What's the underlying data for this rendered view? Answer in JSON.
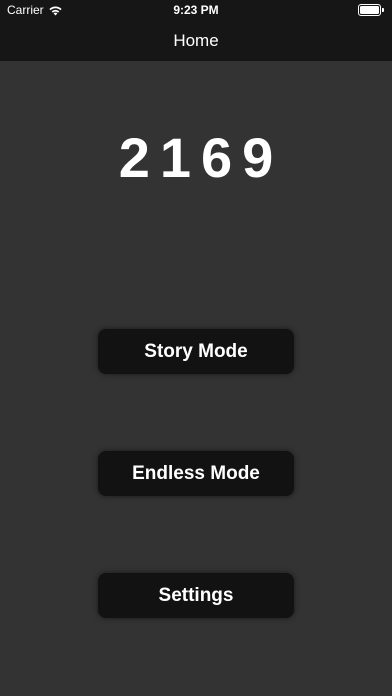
{
  "status_bar": {
    "carrier": "Carrier",
    "time": "9:23 PM",
    "wifi_icon": "wifi-icon",
    "battery_icon": "battery-full-icon"
  },
  "nav": {
    "title": "Home"
  },
  "score": {
    "value": "2169"
  },
  "menu": {
    "story_mode": "Story Mode",
    "endless_mode": "Endless Mode",
    "settings": "Settings"
  },
  "colors": {
    "background": "#333333",
    "topbar": "#161616",
    "button": "#121212",
    "text": "#ffffff"
  }
}
